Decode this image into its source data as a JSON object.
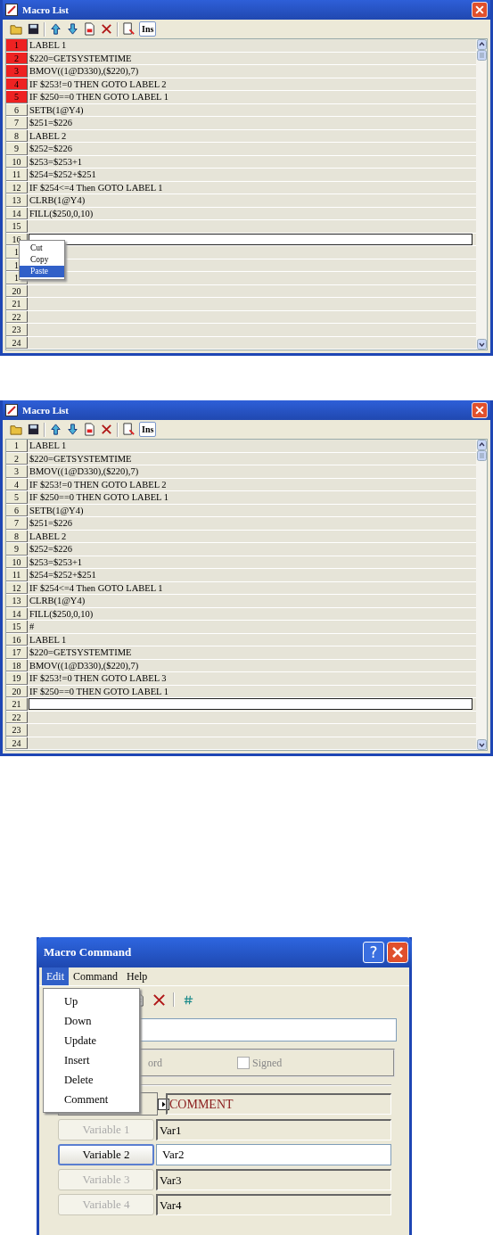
{
  "windows": [
    {
      "title": "Macro List",
      "insert_button": "Ins",
      "rows": [
        {
          "number": "1",
          "text": "LABEL 1",
          "marked": true,
          "kind": "line"
        },
        {
          "number": "2",
          "text": "$220=GETSYSTEMTIME",
          "marked": true,
          "kind": "line"
        },
        {
          "number": "3",
          "text": "BMOV((1@D330),($220),7)",
          "marked": true,
          "kind": "line"
        },
        {
          "number": "4",
          "text": "IF $253!=0 THEN GOTO LABEL 2",
          "marked": true,
          "kind": "line"
        },
        {
          "number": "5",
          "text": "IF $250==0 THEN GOTO LABEL 1",
          "marked": true,
          "kind": "line"
        },
        {
          "number": "6",
          "text": "SETB(1@Y4)",
          "marked": false,
          "kind": "line"
        },
        {
          "number": "7",
          "text": "$251=$226",
          "marked": false,
          "kind": "line"
        },
        {
          "number": "8",
          "text": "LABEL 2",
          "marked": false,
          "kind": "line"
        },
        {
          "number": "9",
          "text": "$252=$226",
          "marked": false,
          "kind": "line"
        },
        {
          "number": "10",
          "text": "$253=$253+1",
          "marked": false,
          "kind": "line"
        },
        {
          "number": "11",
          "text": "$254=$252+$251",
          "marked": false,
          "kind": "line"
        },
        {
          "number": "12",
          "text": "IF $254<=4 Then GOTO LABEL 1",
          "marked": false,
          "kind": "line"
        },
        {
          "number": "13",
          "text": "CLRB(1@Y4)",
          "marked": false,
          "kind": "line"
        },
        {
          "number": "14",
          "text": "FILL($250,0,10)",
          "marked": false,
          "kind": "line"
        },
        {
          "number": "15",
          "marked": false,
          "kind": "line"
        },
        {
          "number": "16",
          "marked": false,
          "kind": "edit"
        },
        {
          "number": "1",
          "marked": false,
          "kind": "line"
        },
        {
          "number": "1",
          "marked": false,
          "kind": "line"
        },
        {
          "number": "1",
          "marked": false,
          "kind": "line"
        },
        {
          "number": "20",
          "marked": false,
          "kind": "line"
        },
        {
          "number": "21",
          "marked": false,
          "kind": "line"
        },
        {
          "number": "22",
          "marked": false,
          "kind": "line"
        },
        {
          "number": "23",
          "marked": false,
          "kind": "line"
        },
        {
          "number": "24",
          "marked": false,
          "kind": "line"
        }
      ],
      "context_menu": {
        "items": [
          {
            "label": "Cut",
            "selected": false
          },
          {
            "label": "Copy",
            "selected": false
          },
          {
            "label": "Paste",
            "selected": true
          }
        ]
      }
    },
    {
      "title": "Macro List",
      "insert_button": "Ins",
      "rows": [
        {
          "number": "1",
          "text": "LABEL 1",
          "marked": false,
          "kind": "line"
        },
        {
          "number": "2",
          "text": "$220=GETSYSTEMTIME",
          "marked": false,
          "kind": "line"
        },
        {
          "number": "3",
          "text": "BMOV((1@D330),($220),7)",
          "marked": false,
          "kind": "line"
        },
        {
          "number": "4",
          "text": "IF $253!=0 THEN GOTO LABEL 2",
          "marked": false,
          "kind": "line"
        },
        {
          "number": "5",
          "text": "IF $250==0 THEN GOTO LABEL 1",
          "marked": false,
          "kind": "line"
        },
        {
          "number": "6",
          "text": "SETB(1@Y4)",
          "marked": false,
          "kind": "line"
        },
        {
          "number": "7",
          "text": "$251=$226",
          "marked": false,
          "kind": "line"
        },
        {
          "number": "8",
          "text": "LABEL 2",
          "marked": false,
          "kind": "line"
        },
        {
          "number": "9",
          "text": "$252=$226",
          "marked": false,
          "kind": "line"
        },
        {
          "number": "10",
          "text": "$253=$253+1",
          "marked": false,
          "kind": "line"
        },
        {
          "number": "11",
          "text": "$254=$252+$251",
          "marked": false,
          "kind": "line"
        },
        {
          "number": "12",
          "text": "IF $254<=4 Then GOTO LABEL 1",
          "marked": false,
          "kind": "line"
        },
        {
          "number": "13",
          "text": "CLRB(1@Y4)",
          "marked": false,
          "kind": "line"
        },
        {
          "number": "14",
          "text": "FILL($250,0,10)",
          "marked": false,
          "kind": "line"
        },
        {
          "number": "15",
          "text": "#",
          "marked": false,
          "kind": "line"
        },
        {
          "number": "16",
          "text": "LABEL 1",
          "marked": false,
          "kind": "line"
        },
        {
          "number": "17",
          "text": "$220=GETSYSTEMTIME",
          "marked": false,
          "kind": "line"
        },
        {
          "number": "18",
          "text": "BMOV((1@D330),($220),7)",
          "marked": false,
          "kind": "line"
        },
        {
          "number": "19",
          "text": "IF $253!=0 THEN GOTO LABEL 3",
          "marked": false,
          "kind": "line"
        },
        {
          "number": "20",
          "text": "IF $250==0 THEN GOTO LABEL 1",
          "marked": false,
          "kind": "line"
        },
        {
          "number": "21",
          "marked": false,
          "kind": "edit"
        },
        {
          "number": "22",
          "marked": false,
          "kind": "line"
        },
        {
          "number": "23",
          "marked": false,
          "kind": "line"
        },
        {
          "number": "24",
          "marked": false,
          "kind": "line"
        }
      ]
    }
  ],
  "dialog": {
    "title": "Macro Command",
    "help_button": "?",
    "menu_bar": [
      {
        "label": "Edit",
        "selected": true
      },
      {
        "label": "Command",
        "selected": false
      },
      {
        "label": "Help",
        "selected": false
      }
    ],
    "edit_menu": [
      "Up",
      "Down",
      "Update",
      "Insert",
      "Delete",
      "Comment"
    ],
    "option_label": "ord",
    "signed_checkbox": {
      "label": "Signed",
      "checked": false
    },
    "command_value": "COMMENT",
    "variables": [
      {
        "label": "Variable 1",
        "value": "Var1",
        "disabled": true
      },
      {
        "label": "Variable 2",
        "value": "Var2",
        "disabled": false
      },
      {
        "label": "Variable 3",
        "value": "Var3",
        "disabled": true
      },
      {
        "label": "Variable 4",
        "value": "Var4",
        "disabled": true
      }
    ]
  }
}
